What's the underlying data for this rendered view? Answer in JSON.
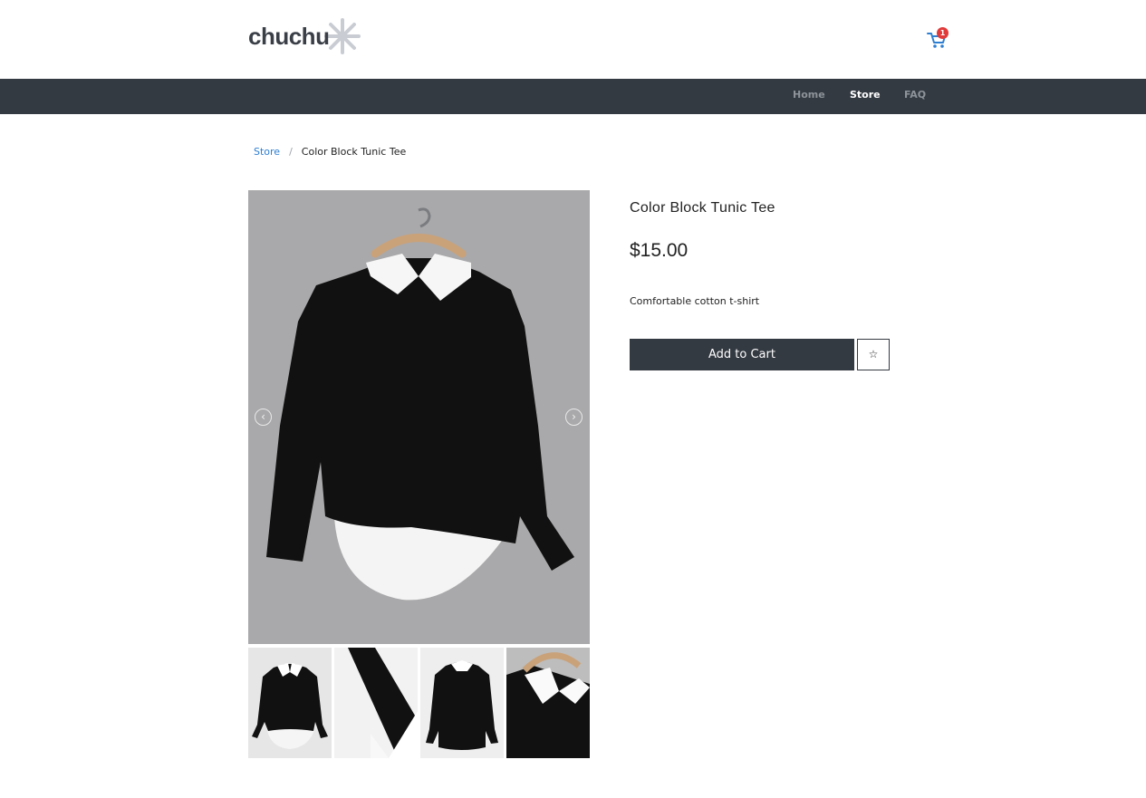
{
  "brand": {
    "name": "chuchu"
  },
  "cart": {
    "icon": "cart-icon",
    "count": "1"
  },
  "nav": {
    "items": [
      {
        "label": "Home",
        "active": false
      },
      {
        "label": "Store",
        "active": true
      },
      {
        "label": "FAQ",
        "active": false
      }
    ]
  },
  "breadcrumb": {
    "parent": "Store",
    "separator": "/",
    "current": "Color Block Tunic Tee"
  },
  "product": {
    "title": "Color Block Tunic Tee",
    "price": "$15.00",
    "description": "Comfortable cotton t-shirt",
    "add_to_cart_label": "Add to Cart",
    "favorite_icon": "☆"
  },
  "gallery": {
    "prev_icon": "‹",
    "next_icon": "›",
    "thumbnails": [
      "front-view",
      "sleeve-detail",
      "back-view",
      "collar-detail"
    ]
  },
  "colors": {
    "nav_bg": "#343a42",
    "link": "#2f7fd1",
    "badge": "#e03a3a"
  }
}
